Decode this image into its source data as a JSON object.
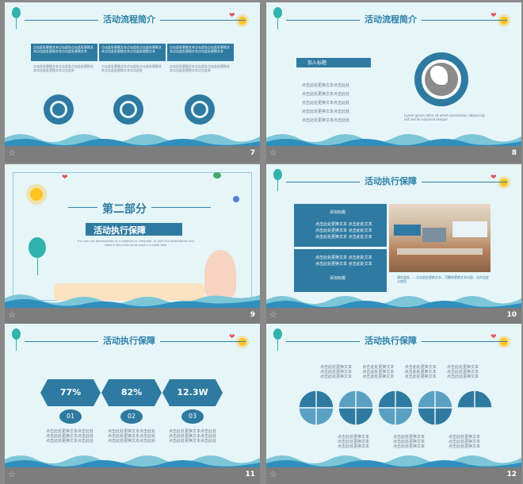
{
  "slides": [
    {
      "num": "7",
      "title": "活动流程简介",
      "box_text": "点击此处更换文本点击此处点击此处更换文本点击此处更换文本点击此处更换文本",
      "sub_text": "点击此处更换文本点击此处点击此处更换文本点击此处更换文本点击此处",
      "icons": [
        "lightbulb-icon",
        "chart-icon",
        "flag-icon"
      ]
    },
    {
      "num": "8",
      "title": "活动流程简介",
      "label": "加入标题",
      "bullets": [
        "点击此处更换文本点击此处",
        "点击此处更换文本点击此处",
        "点击此处更换文本点击此处",
        "点击此处更换文本点击此处",
        "点击此处更换文本点击此处"
      ],
      "caption": "Lorem ipsum dolor sit amet consectetur adipiscing elit sed do eiusmod tempor"
    },
    {
      "num": "9",
      "part": "第二部分",
      "title": "活动执行保障",
      "desc": "The user can demonstrate on a projector or computer, or print the presentation and make it into a film to be used in a wider field"
    },
    {
      "num": "10",
      "title": "活动执行保障",
      "left_top_label": "添加标题",
      "left_top_lines": [
        "点击此处更换文本 点击此处文本",
        "点击此处更换文本 点击此处文本",
        "点击此处更换文本 点击此处文本"
      ],
      "left_bottom_lines": [
        "点击此处更换文本 点击此处文本",
        "点击此处更换文本 点击此处文本"
      ],
      "left_bottom_label": "添加标题",
      "caption": "请在此处……点击此处更换文本，可删除更换文本内容，允许自定义使用"
    },
    {
      "num": "11",
      "title": "活动执行保障",
      "stats": [
        {
          "value": "77%",
          "index": "01"
        },
        {
          "value": "82%",
          "index": "02"
        },
        {
          "value": "12.3W",
          "index": "03"
        }
      ],
      "stat_text": "点击此处更换文本点击此处"
    },
    {
      "num": "12",
      "title": "活动执行保障",
      "top_text": "点击此处更换文本",
      "bottom_text": "点击此处更换文本"
    }
  ],
  "colors": {
    "primary": "#2e7aa1",
    "slide_bg": "#e6f5f8",
    "title": "#2e82a9",
    "sun": "#ffc423",
    "balloon": "#2fb3ac"
  }
}
